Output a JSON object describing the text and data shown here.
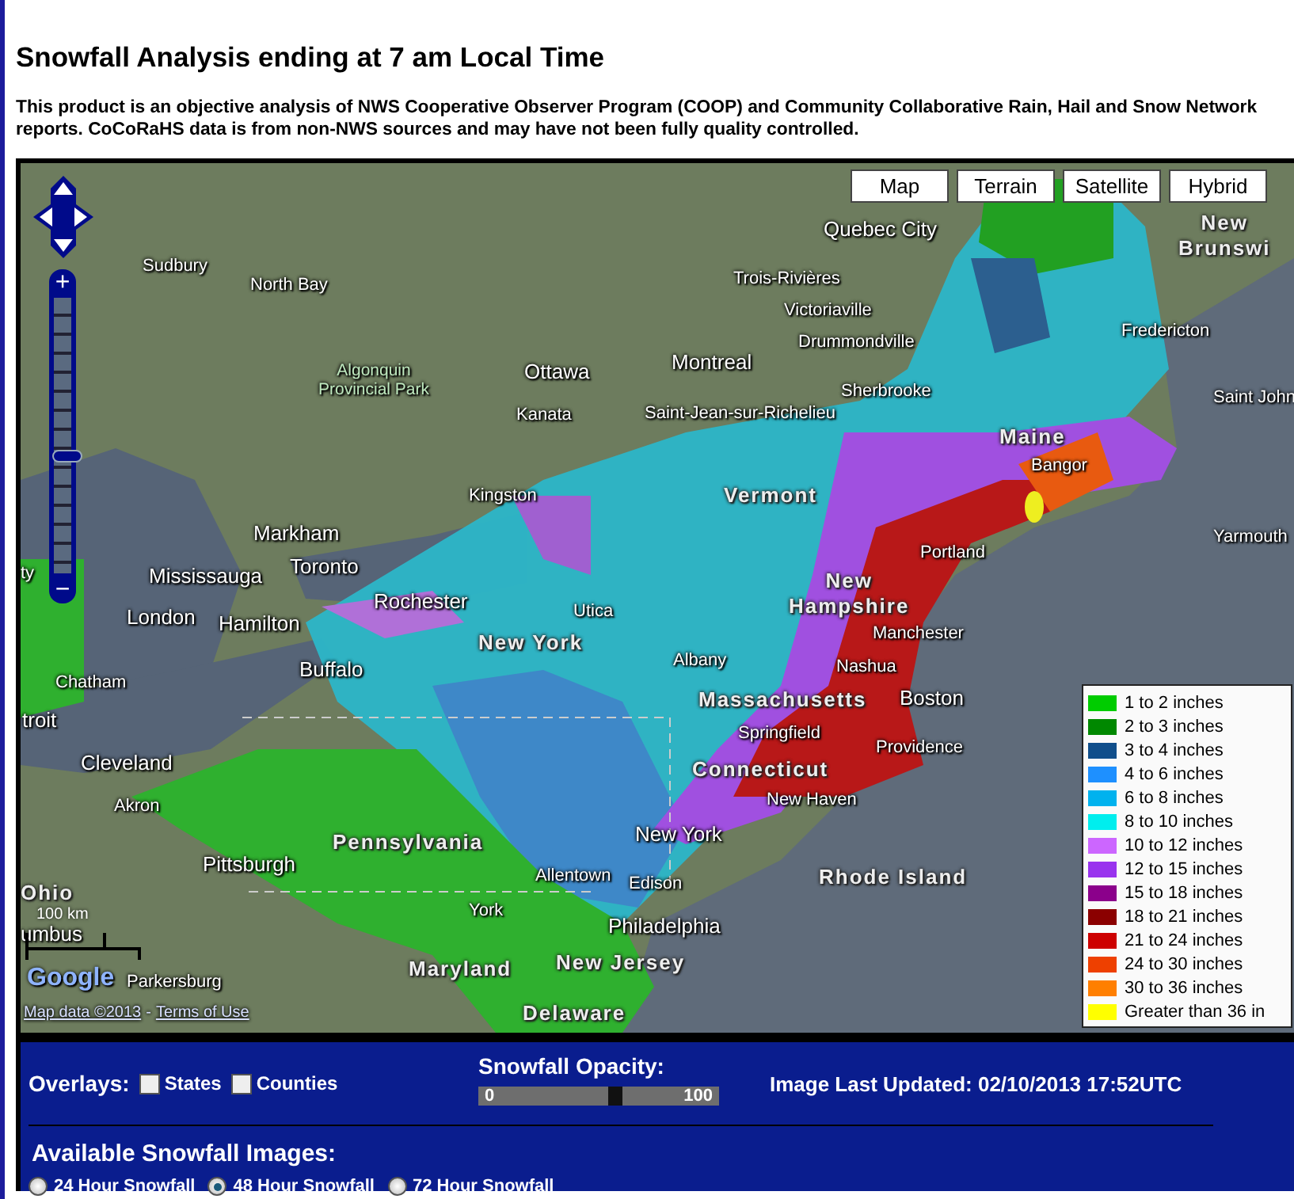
{
  "title": "Snowfall Analysis ending at 7 am Local Time",
  "description": "This product is an objective analysis of NWS Cooperative Observer Program (COOP) and Community Collaborative Rain, Hail and Snow Network reports.  CoCoRaHS data is from non-NWS sources and may have not been fully quality controlled.",
  "map": {
    "map_types": [
      {
        "label": "Map"
      },
      {
        "label": "Terrain"
      },
      {
        "label": "Satellite"
      },
      {
        "label": "Hybrid"
      }
    ],
    "zoom": {
      "level": 0.42,
      "in": "+",
      "out": "−"
    },
    "labels": [
      {
        "text": "Sudbury",
        "kind": "city"
      },
      {
        "text": "North Bay",
        "kind": "city"
      },
      {
        "text": "Algonquin Provincial Park",
        "kind": "park"
      },
      {
        "text": "Ottawa",
        "kind": "bigcity"
      },
      {
        "text": "Kanata",
        "kind": "city"
      },
      {
        "text": "Quebec City",
        "kind": "bigcity"
      },
      {
        "text": "Trois-Rivières",
        "kind": "city"
      },
      {
        "text": "Victoriaville",
        "kind": "city"
      },
      {
        "text": "Drummondville",
        "kind": "city"
      },
      {
        "text": "Montreal",
        "kind": "bigcity"
      },
      {
        "text": "Sherbrooke",
        "kind": "city"
      },
      {
        "text": "Saint-Jean-sur-Richelieu",
        "kind": "city"
      },
      {
        "text": "New Brunswi",
        "kind": "stacked"
      },
      {
        "text": "Fredericton",
        "kind": "city"
      },
      {
        "text": "Saint John",
        "kind": "city"
      },
      {
        "text": "Maine",
        "kind": "state"
      },
      {
        "text": "Bangor",
        "kind": "city"
      },
      {
        "text": "Yarmouth",
        "kind": "city"
      },
      {
        "text": "Kingston",
        "kind": "city"
      },
      {
        "text": "Vermont",
        "kind": "state"
      },
      {
        "text": "Markham",
        "kind": "bigcity"
      },
      {
        "text": "Mississauga",
        "kind": "bigcity"
      },
      {
        "text": "Toronto",
        "kind": "bigcity"
      },
      {
        "text": "Portland",
        "kind": "city"
      },
      {
        "text": "New Hampshire",
        "kind": "stacked"
      },
      {
        "text": "Manchester",
        "kind": "city"
      },
      {
        "text": "Nashua",
        "kind": "city"
      },
      {
        "text": "Boston",
        "kind": "bigcity"
      },
      {
        "text": "Albany",
        "kind": "city"
      },
      {
        "text": "Rochester",
        "kind": "bigcity"
      },
      {
        "text": "Utica",
        "kind": "city"
      },
      {
        "text": "New York",
        "kind": "state"
      },
      {
        "text": "London",
        "kind": "bigcity"
      },
      {
        "text": "Hamilton",
        "kind": "bigcity"
      },
      {
        "text": "Buffalo",
        "kind": "bigcity"
      },
      {
        "text": "Chatham",
        "kind": "city"
      },
      {
        "text": "ty",
        "kind": "city"
      },
      {
        "text": "troit",
        "kind": "bigcity"
      },
      {
        "text": "Massachusetts",
        "kind": "state"
      },
      {
        "text": "Springfield",
        "kind": "city"
      },
      {
        "text": "Providence",
        "kind": "city"
      },
      {
        "text": "Connecticut",
        "kind": "state"
      },
      {
        "text": "New Haven",
        "kind": "city"
      },
      {
        "text": "Rhode Island",
        "kind": "state"
      },
      {
        "text": "Cleveland",
        "kind": "bigcity"
      },
      {
        "text": "Akron",
        "kind": "city"
      },
      {
        "text": "Pennsylvania",
        "kind": "state"
      },
      {
        "text": "Pittsburgh",
        "kind": "bigcity"
      },
      {
        "text": "Ohio",
        "kind": "state"
      },
      {
        "text": "New York",
        "kind": "bigcity"
      },
      {
        "text": "Allentown",
        "kind": "city"
      },
      {
        "text": "Edison",
        "kind": "city"
      },
      {
        "text": "York",
        "kind": "city"
      },
      {
        "text": "Philadelphia",
        "kind": "bigcity"
      },
      {
        "text": "Maryland",
        "kind": "state"
      },
      {
        "text": "New Jersey",
        "kind": "state"
      },
      {
        "text": "umbus",
        "kind": "bigcity"
      },
      {
        "text": "Parkersburg",
        "kind": "city"
      },
      {
        "text": "Delaware",
        "kind": "state"
      }
    ],
    "scale": "100 km",
    "logo": "Google",
    "attribution": {
      "data_link": "Map data ©2013",
      "separator": "-",
      "terms_link": "Terms of Use"
    },
    "legend": [
      {
        "label": "1 to 2 inches",
        "color": "#00cc00"
      },
      {
        "label": "2 to 3 inches",
        "color": "#008800"
      },
      {
        "label": "3 to 4 inches",
        "color": "#104e8b"
      },
      {
        "label": "4 to 6 inches",
        "color": "#1e90ff"
      },
      {
        "label": "6 to 8 inches",
        "color": "#00b2ee"
      },
      {
        "label": "8 to 10 inches",
        "color": "#00eeee"
      },
      {
        "label": "10 to 12 inches",
        "color": "#cc66ff"
      },
      {
        "label": "12 to 15 inches",
        "color": "#9933ee"
      },
      {
        "label": "15 to 18 inches",
        "color": "#8b008b"
      },
      {
        "label": "18 to 21 inches",
        "color": "#8b0000"
      },
      {
        "label": "21 to 24 inches",
        "color": "#cd0000"
      },
      {
        "label": "24 to 30 inches",
        "color": "#ee4000"
      },
      {
        "label": "30 to 36 inches",
        "color": "#ff7f00"
      },
      {
        "label": "Greater than 36 in",
        "color": "#ffff00"
      }
    ]
  },
  "controls": {
    "overlays_label": "Overlays:",
    "overlays": [
      {
        "label": "States",
        "checked": false
      },
      {
        "label": "Counties",
        "checked": false
      }
    ],
    "opacity": {
      "label": "Snowfall Opacity:",
      "min": "0",
      "max": "100",
      "level": 0.57
    },
    "updated": "Image Last Updated: 02/10/2013 17:52UTC",
    "images_label": "Available Snowfall Images:",
    "images": [
      {
        "label": "24 Hour Snowfall",
        "selected": false
      },
      {
        "label": "48 Hour Snowfall",
        "selected": true
      },
      {
        "label": "72 Hour Snowfall",
        "selected": false
      }
    ]
  }
}
